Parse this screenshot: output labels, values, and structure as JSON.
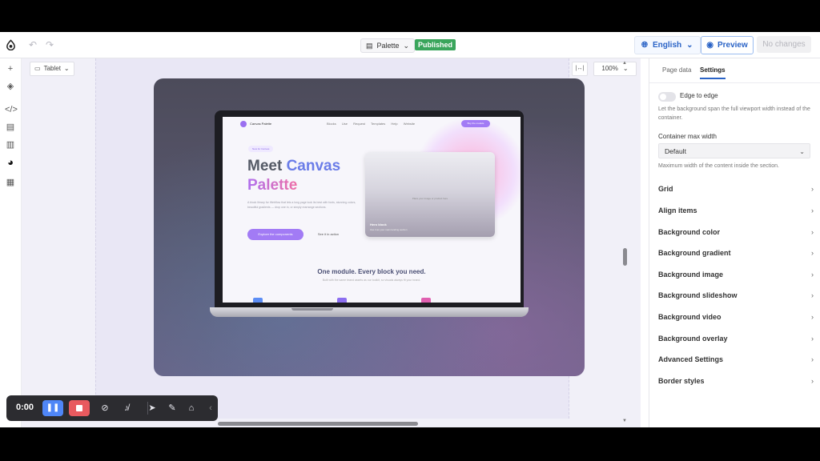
{
  "topbar": {
    "page_select": "Palette",
    "status_badge": "Published",
    "language": "English",
    "preview_label": "Preview",
    "save_state": "No changes"
  },
  "canvas": {
    "device_select": "Tablet",
    "zoom": "100%"
  },
  "site": {
    "brand": "Canvas Palette",
    "nav_links": "Blocks  Use  Request  Templates  Help  Website",
    "nav_cta": "Buy the module",
    "pill": "New for Canvas",
    "h1_line1_a": "Meet ",
    "h1_line1_b": "Canvas",
    "h1_line2": "Palette",
    "paragraph": "A block library for Webflow that lets a long page look its best with fonts, stunning colors, beautiful gradients — drop one in, or simply rearrange sections.",
    "btn_primary": "Explore the components",
    "btn_secondary": "See it in action",
    "card_caption": "Place your image or product here",
    "card_title": "Hero block",
    "card_desc": "Use it as your main landing section",
    "h2": "One module. Every block you need.",
    "sub": "Built with the same brand assets as our toolkit, so visuals always fit your brand."
  },
  "panel": {
    "tabs": [
      "Page data",
      "Settings"
    ],
    "active_tab": "Settings",
    "toggle_label": "Edge to edge",
    "toggle_on": false,
    "toggle_help": "Let the background span the full viewport width instead of the container.",
    "container_label": "Container max width",
    "container_value": "Default",
    "container_help": "Maximum width of the content inside the section.",
    "sections": [
      "Grid",
      "Align items",
      "Background color",
      "Background gradient",
      "Background image",
      "Background slideshow",
      "Background video",
      "Background overlay",
      "Advanced Settings",
      "Border styles"
    ]
  },
  "recorder": {
    "time": "0:00"
  },
  "colors": {
    "accent": "#2a63c6",
    "published": "#3aa55c",
    "record_pause": "#4f86f7",
    "record_stop": "#e85a5f"
  }
}
